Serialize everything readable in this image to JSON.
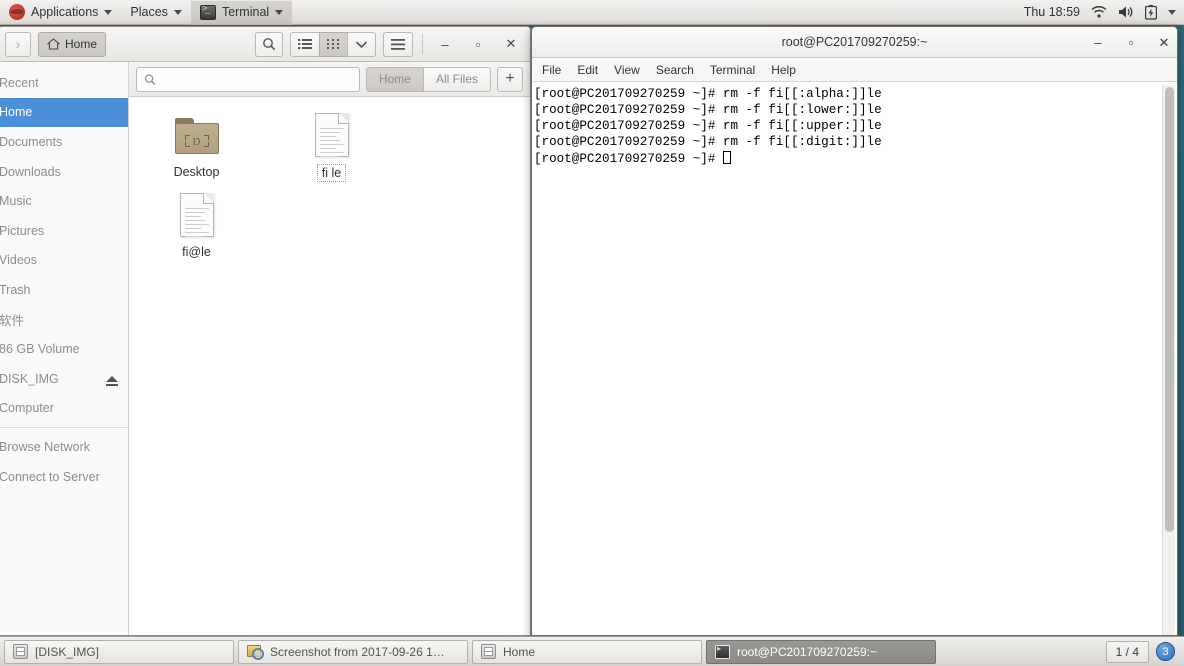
{
  "top_panel": {
    "applications_label": "Applications",
    "places_label": "Places",
    "active_app_label": "Terminal",
    "clock": "Thu 18:59",
    "tray_icons": [
      "wifi-icon",
      "volume-icon",
      "battery-icon",
      "chevron-down-icon"
    ]
  },
  "file_manager": {
    "forward_button_label": "›",
    "home_button_label": "Home",
    "toolbar_icons": [
      "search-icon",
      "list-view-icon",
      "grid-view-icon",
      "chevron-down-icon",
      "menu-icon"
    ],
    "window_controls": {
      "minimize": "–",
      "maximize": "▫",
      "close": "✕"
    },
    "search": {
      "value": "",
      "placeholder": ""
    },
    "location_buttons": [
      {
        "label": "Home",
        "active": true
      },
      {
        "label": "All Files",
        "active": false
      }
    ],
    "new_tab_label": "+",
    "sidebar": [
      {
        "label": "Recent",
        "selected": false,
        "eject": false
      },
      {
        "label": "Home",
        "selected": true,
        "eject": false
      },
      {
        "label": "Documents",
        "selected": false,
        "eject": false
      },
      {
        "label": "Downloads",
        "selected": false,
        "eject": false
      },
      {
        "label": "Music",
        "selected": false,
        "eject": false
      },
      {
        "label": "Pictures",
        "selected": false,
        "eject": false
      },
      {
        "label": "Videos",
        "selected": false,
        "eject": false
      },
      {
        "label": "Trash",
        "selected": false,
        "eject": false
      },
      {
        "label": "软件",
        "selected": false,
        "eject": false
      },
      {
        "label": "86 GB Volume",
        "selected": false,
        "eject": false
      },
      {
        "label": "DISK_IMG",
        "selected": false,
        "eject": true
      },
      {
        "label": "Computer",
        "selected": false,
        "eject": false
      },
      {
        "label": "Browse Network",
        "selected": false,
        "eject": false
      },
      {
        "label": "Connect to Server",
        "selected": false,
        "eject": false
      }
    ],
    "files": [
      {
        "name": "Desktop",
        "type": "folder",
        "focused": false,
        "emblem": "D"
      },
      {
        "name": "fi le",
        "type": "document",
        "focused": true
      },
      {
        "name": "fi@le",
        "type": "document",
        "focused": false
      }
    ]
  },
  "terminal": {
    "title": "root@PC201709270259:~",
    "menu": [
      "File",
      "Edit",
      "View",
      "Search",
      "Terminal",
      "Help"
    ],
    "window_controls": {
      "minimize": "–",
      "maximize": "▫",
      "close": "✕"
    },
    "lines": [
      "[root@PC201709270259 ~]# rm -f fi[[:alpha:]]le",
      "[root@PC201709270259 ~]# rm -f fi[[:lower:]]le",
      "[root@PC201709270259 ~]# rm -f fi[[:upper:]]le",
      "[root@PC201709270259 ~]# rm -f fi[[:digit:]]le"
    ],
    "prompt": "[root@PC201709270259 ~]# "
  },
  "taskbar": {
    "items": [
      {
        "label": "[DISK_IMG]",
        "icon": "disk-icon",
        "active": false
      },
      {
        "label": "Screenshot from 2017-09-26 1…",
        "icon": "screenshot-icon",
        "active": false
      },
      {
        "label": "Home",
        "icon": "disk-icon",
        "active": false
      },
      {
        "label": "root@PC201709270259:~",
        "icon": "terminal-icon",
        "active": true
      }
    ],
    "workspace_indicator": "1 / 4",
    "workspace_badge": "3"
  },
  "colors": {
    "accent_blue": "#4a90d9",
    "desktop_teal": "#2d6675",
    "panel_grey": "#e8e6e3"
  }
}
